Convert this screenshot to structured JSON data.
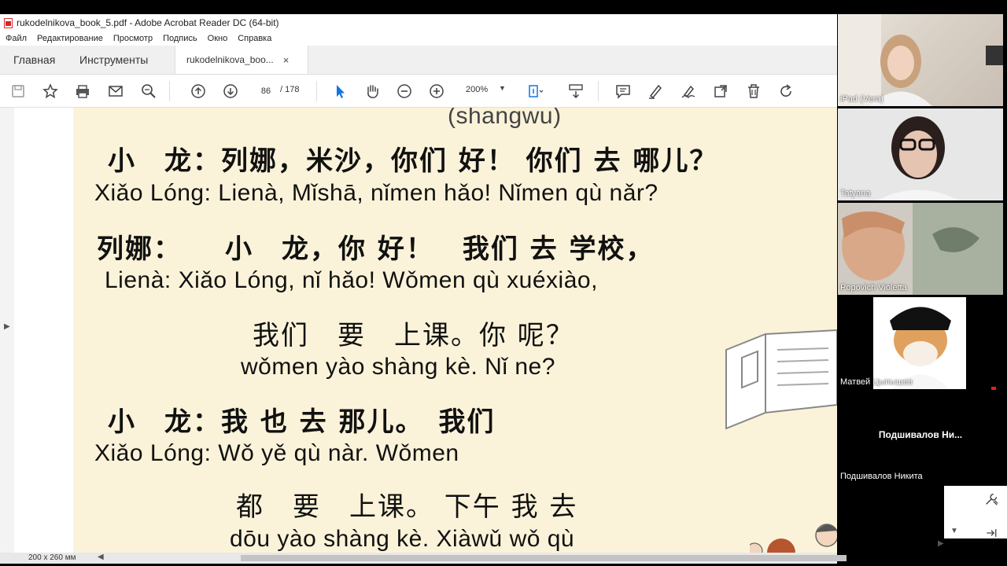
{
  "window": {
    "title": "rukodelnikova_book_5.pdf - Adobe Acrobat Reader DC (64-bit)"
  },
  "menu": [
    "Файл",
    "Редактирование",
    "Просмотр",
    "Подпись",
    "Окно",
    "Справка"
  ],
  "tabs": {
    "home": "Главная",
    "tools": "Инструменты",
    "document": "rukodelnikova_boo...",
    "close": "×"
  },
  "toolbar": {
    "page_current": "86",
    "page_total": "/ 178",
    "zoom": "200%"
  },
  "document": {
    "top_cut": "(shangwu)",
    "lines": [
      {
        "hz": "小　龙：列娜，米沙，你们 好！ 你们 去 哪儿？",
        "py": "Xiǎo Lóng: Lienà,  Mǐshā,  nǐmen hǎo!  Nǐmen qù   nǎr?"
      },
      {
        "hz": "列娜：　　小　龙，你 好！　我们 去 学校，",
        "py": "Lienà:        Xiǎo Lóng,  nǐ  hǎo!  Wǒmen qù  xuéxiào,"
      },
      {
        "hz": "我们　要　上课。你 呢？",
        "py": "wǒmen  yào  shàng kè.  Nǐ   ne?"
      },
      {
        "hz": "小　龙：我 也 去 那儿。　我们",
        "py": "Xiǎo Lóng: Wǒ yě qù   nàr.    Wǒmen"
      },
      {
        "hz": "都　要　上课。 下午 我 去",
        "py": "dōu yào shàng kè. Xiàwǔ wǒ qù"
      }
    ]
  },
  "status": {
    "page_size": "200 x 260 мм"
  },
  "participants": [
    {
      "name": "iPad (Vera)"
    },
    {
      "name": "Tatyana"
    },
    {
      "name": "Popovich Violetta"
    },
    {
      "name": "Матвей Цыпышев"
    },
    {
      "name": "Подшивалов Никита",
      "title": "Подшивалов  Ни..."
    }
  ],
  "colors": {
    "accent_blue": "#1473e6",
    "page_bg": "#fbf3d9"
  }
}
